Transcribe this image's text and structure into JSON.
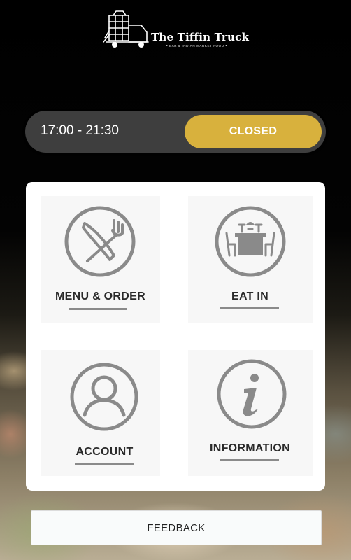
{
  "brand": {
    "name": "The Tiffin Truck",
    "tagline": "• BAR & INDIAN MARKET FOOD •"
  },
  "hours": {
    "time_range": "17:00 - 21:30",
    "status": "CLOSED"
  },
  "menu": {
    "tiles": [
      {
        "label": "MENU & ORDER",
        "icon": "knife-fork-icon"
      },
      {
        "label": "EAT IN",
        "icon": "dining-table-icon"
      },
      {
        "label": "ACCOUNT",
        "icon": "user-icon"
      },
      {
        "label": "INFORMATION",
        "icon": "info-icon"
      }
    ]
  },
  "footer": {
    "feedback_label": "FEEDBACK"
  },
  "colors": {
    "accent": "#d8b13d",
    "pill_bg": "#3e3e3e",
    "icon_grey": "#8a8a8a"
  }
}
